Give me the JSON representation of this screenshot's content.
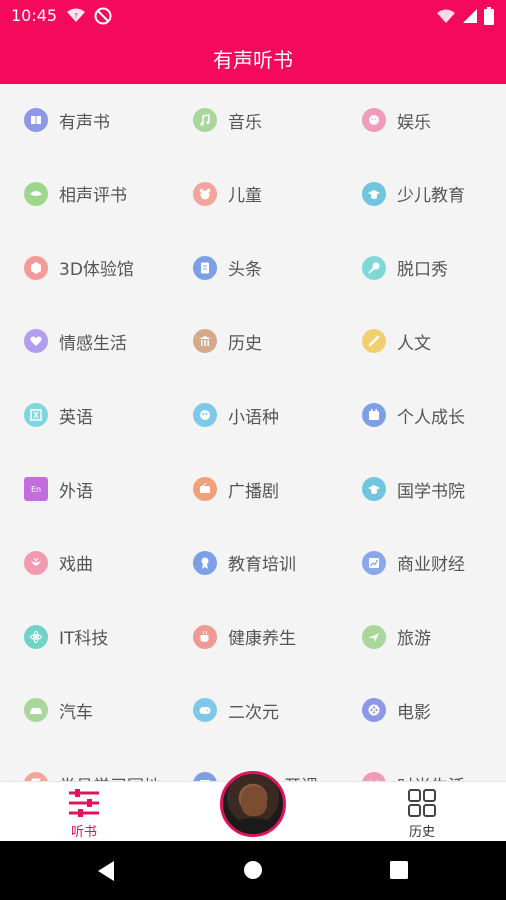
{
  "status_bar": {
    "time": "10:45",
    "icons": [
      "wifi-question-icon",
      "dnd-icon",
      "wifi-icon",
      "signal-icon",
      "battery-icon"
    ]
  },
  "app_bar": {
    "title": "有声听书"
  },
  "categories": [
    {
      "label": "有声书",
      "icon": "book-icon",
      "color": "#8f97e8"
    },
    {
      "label": "音乐",
      "icon": "music-icon",
      "color": "#a9d69a"
    },
    {
      "label": "娱乐",
      "icon": "smile-icon",
      "color": "#f19ab9"
    },
    {
      "label": "相声评书",
      "icon": "fan-icon",
      "color": "#9fd68e"
    },
    {
      "label": "儿童",
      "icon": "bear-icon",
      "color": "#f4a49a"
    },
    {
      "label": "少儿教育",
      "icon": "graduation-cap-icon",
      "color": "#6fc6de"
    },
    {
      "label": "3D体验馆",
      "icon": "cube-icon",
      "color": "#f59a96"
    },
    {
      "label": "头条",
      "icon": "document-icon",
      "color": "#7d9fe6"
    },
    {
      "label": "脱口秀",
      "icon": "microphone-icon",
      "color": "#7fd8d8"
    },
    {
      "label": "情感生活",
      "icon": "heart-icon",
      "color": "#b29ef0"
    },
    {
      "label": "历史",
      "icon": "temple-icon",
      "color": "#d7a98c"
    },
    {
      "label": "人文",
      "icon": "brush-icon",
      "color": "#f2cf6e"
    },
    {
      "label": "英语",
      "icon": "translate-icon",
      "color": "#7fd6e3"
    },
    {
      "label": "小语种",
      "icon": "globe-icon",
      "color": "#7ec8ea"
    },
    {
      "label": "个人成长",
      "icon": "calendar-icon",
      "color": "#7d9fe6"
    },
    {
      "label": "外语",
      "icon": "en-icon",
      "color": "#c26ddf"
    },
    {
      "label": "广播剧",
      "icon": "radio-icon",
      "color": "#f2a07a"
    },
    {
      "label": "国学书院",
      "icon": "graduation-cap-icon",
      "color": "#6fc6de"
    },
    {
      "label": "戏曲",
      "icon": "opera-icon",
      "color": "#f19ab0"
    },
    {
      "label": "教育培训",
      "icon": "award-icon",
      "color": "#7d9fe6"
    },
    {
      "label": "商业财经",
      "icon": "chart-icon",
      "color": "#8aa7ea"
    },
    {
      "label": "IT科技",
      "icon": "atom-icon",
      "color": "#6fd4c6"
    },
    {
      "label": "健康养生",
      "icon": "cup-icon",
      "color": "#f09a96"
    },
    {
      "label": "旅游",
      "icon": "plane-icon",
      "color": "#a9d69a"
    },
    {
      "label": "汽车",
      "icon": "car-icon",
      "color": "#a9d69a"
    },
    {
      "label": "二次元",
      "icon": "gamepad-icon",
      "color": "#7ec8ea"
    },
    {
      "label": "电影",
      "icon": "film-icon",
      "color": "#8f97e8"
    },
    {
      "label": "党员学习园地",
      "icon": "flag-icon",
      "color": "#f4a49a"
    },
    {
      "label": "",
      "icon": "class-icon",
      "color": "#7d9fe6",
      "tail": "开课"
    },
    {
      "label": "时尚生活",
      "icon": "fashion-icon",
      "color": "#f19ab9"
    }
  ],
  "bottom_nav": {
    "listen_label": "听书",
    "history_label": "历史"
  },
  "colors": {
    "brand": "#f5095a",
    "active": "#e0145a"
  }
}
